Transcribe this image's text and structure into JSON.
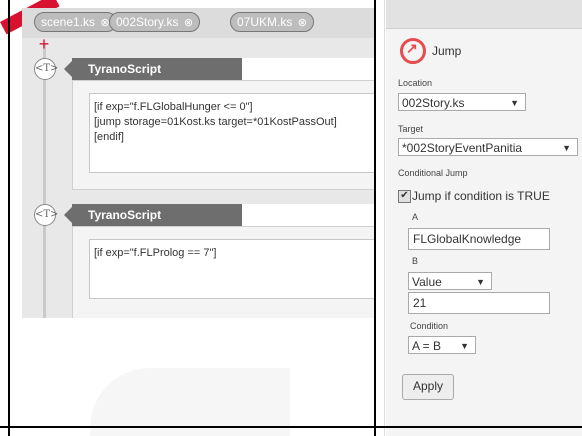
{
  "tabs": [
    {
      "label": "scene1.ks",
      "close": "⊗"
    },
    {
      "label": "002Story.ks",
      "close": "⊗"
    },
    {
      "label": "07UKM.ks",
      "close": "⊗"
    }
  ],
  "timeline": {
    "node_icon": "<T>",
    "blocks": [
      {
        "title": "TyranoScript",
        "code": "[if exp=\"f.FLGlobalHunger <= 0\"]\n[jump storage=01Kost.ks target=*01KostPassOut]\n[endif]"
      },
      {
        "title": "TyranoScript",
        "code": "[if exp=\"f.FLProlog == 7\"]"
      }
    ]
  },
  "jump_panel": {
    "title": "Jump",
    "location_label": "Location",
    "location_value": "002Story.ks",
    "target_label": "Target",
    "target_value": "*002StoryEventPanitia",
    "conditional_label": "Conditional Jump",
    "checkbox_label": "Jump if condition is TRUE",
    "checkbox_checked": true,
    "a_label": "A",
    "a_value": "FLGlobalKnowledge",
    "b_label": "B",
    "b_type": "Value",
    "b_value": "21",
    "condition_label": "Condition",
    "condition_value": "A = B",
    "apply_label": "Apply"
  },
  "colors": {
    "accent": "#d8112f",
    "block_header": "#6e6e6e",
    "jump_icon": "#e74c4c"
  }
}
